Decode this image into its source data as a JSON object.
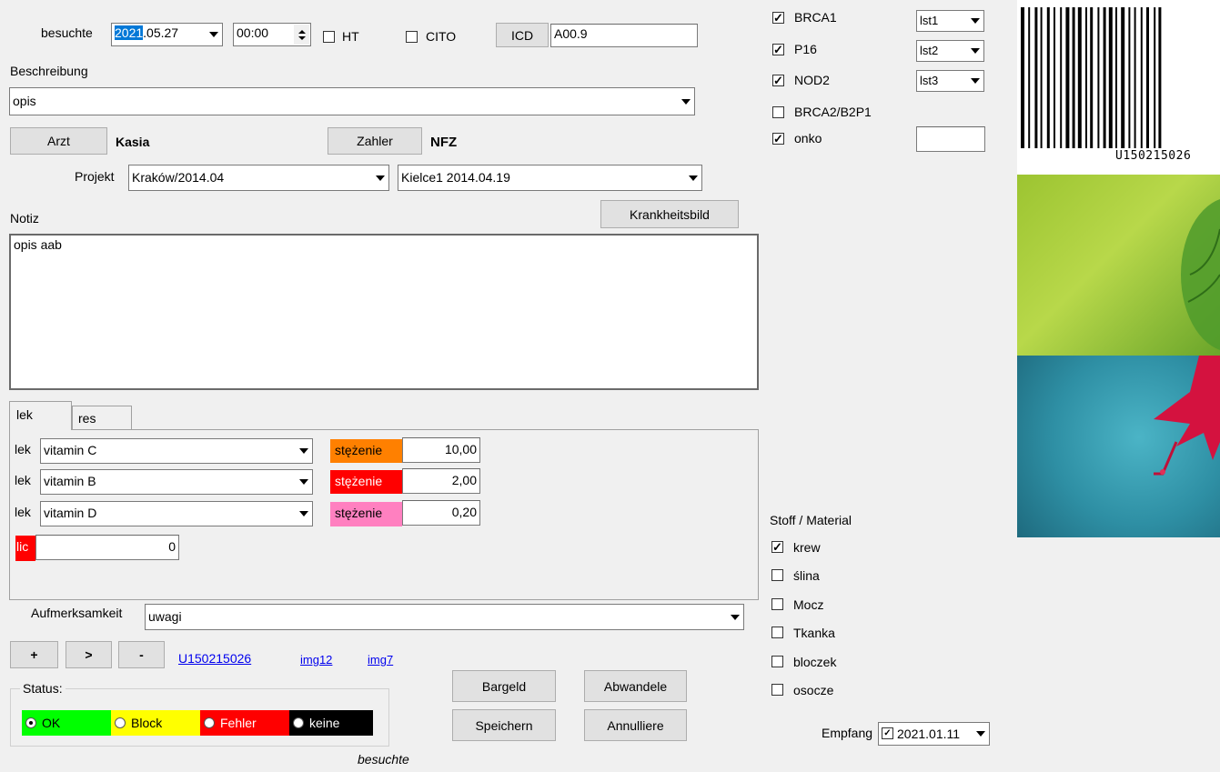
{
  "visit": {
    "label": "besuchte",
    "date_year_selected": "2021",
    "date_rest": ".05.27",
    "time": "00:00",
    "ht_label": "HT",
    "cito_label": "CITO",
    "icd_button": "ICD",
    "icd_value": "A00.9"
  },
  "description": {
    "label": "Beschreibung",
    "value": "opis"
  },
  "doctor": {
    "button": "Arzt",
    "value": "Kasia"
  },
  "payer": {
    "button": "Zahler",
    "value": "NFZ"
  },
  "project": {
    "label": "Projekt",
    "value": "Kraków/2014.04",
    "sub_value": "Kielce1 2014.04.19"
  },
  "note": {
    "label": "Notiz",
    "button": "Krankheitsbild",
    "value": "opis aab"
  },
  "tabs": [
    {
      "label": "lek"
    },
    {
      "label": "res"
    }
  ],
  "drugs": {
    "rows": [
      {
        "label": "lek",
        "value": "vitamin C",
        "conc_label": "stężenie",
        "conc_value": "10,00",
        "color": "#ff8000"
      },
      {
        "label": "lek",
        "value": "vitamin B",
        "conc_label": "stężenie",
        "conc_value": "2,00",
        "color": "#ff0000"
      },
      {
        "label": "lek",
        "value": "vitamin D",
        "conc_label": "stężenie",
        "conc_value": "0,20",
        "color": "#ff80c0"
      }
    ],
    "lic_label": "lic",
    "lic_value": "0"
  },
  "attention": {
    "label": "Aufmerksamkeit",
    "value": "uwagi"
  },
  "nav_buttons": {
    "add": "+",
    "next": ">",
    "remove": "-"
  },
  "links": {
    "barcode": "U150215026",
    "img1": "img12",
    "img2": "img7"
  },
  "status": {
    "label": "Status:",
    "options": [
      {
        "label": "OK",
        "color": "#00ff00",
        "text_color": "#000000",
        "selected": true
      },
      {
        "label": "Block",
        "color": "#ffff00",
        "text_color": "#000000",
        "selected": false
      },
      {
        "label": "Fehler",
        "color": "#ff0000",
        "text_color": "#ffffff",
        "selected": false
      },
      {
        "label": "keine",
        "color": "#000000",
        "text_color": "#ffffff",
        "selected": false
      }
    ]
  },
  "actions": {
    "cash": "Bargeld",
    "modify": "Abwandele",
    "save": "Speichern",
    "cancel": "Annulliere"
  },
  "footer": {
    "status": "besuchte"
  },
  "genes": [
    {
      "label": "BRCA1",
      "checked": true,
      "list": "lst1"
    },
    {
      "label": "P16",
      "checked": true,
      "list": "lst2"
    },
    {
      "label": "NOD2",
      "checked": true,
      "list": "lst3"
    },
    {
      "label": "BRCA2/B2P1",
      "checked": false
    },
    {
      "label": "onko",
      "checked": true,
      "input": ""
    }
  ],
  "material": {
    "label": "Stoff / Material",
    "items": [
      {
        "label": "krew",
        "checked": true
      },
      {
        "label": "ślina",
        "checked": false
      },
      {
        "label": "Mocz",
        "checked": false
      },
      {
        "label": "Tkanka",
        "checked": false
      },
      {
        "label": "bloczek",
        "checked": false
      },
      {
        "label": "osocze",
        "checked": false
      }
    ]
  },
  "reception": {
    "label": "Empfang",
    "date": "2021.01.11",
    "checked": true
  },
  "barcode_text": "U150215026"
}
